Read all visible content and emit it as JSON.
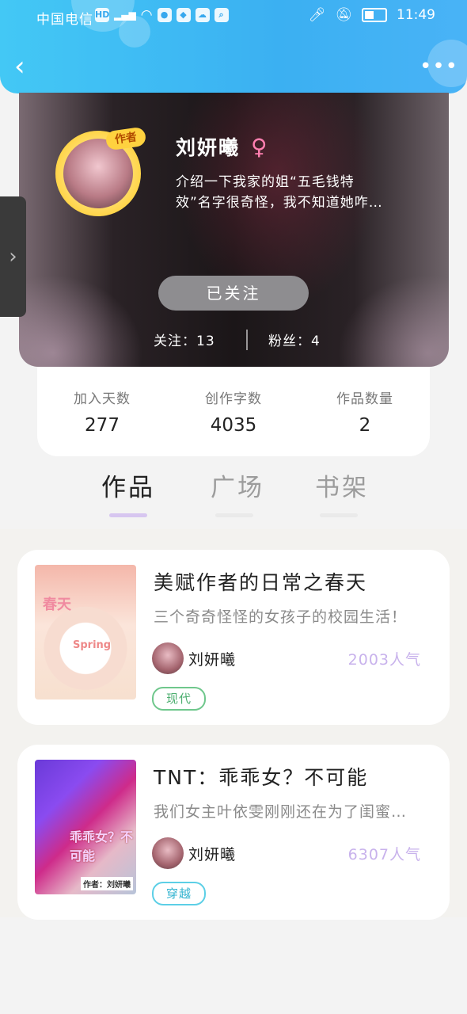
{
  "status_bar": {
    "carrier": "中国电信",
    "network": "HD 4G",
    "time": "11:49"
  },
  "header": {
    "back_icon": "chevron-left-icon",
    "more_icon": "more-icon"
  },
  "profile": {
    "avatar_badge": "作者",
    "name": "刘妍曦",
    "gender_symbol": "♀",
    "bio_line1": "介绍一下我家的姐“五毛钱特",
    "bio_line2": "效”名字很奇怪，我不知道她咋…",
    "follow_button": "已关注",
    "following_label": "关注：",
    "following_count": "13",
    "fans_label": "粉丝：",
    "fans_count": "4"
  },
  "stats": [
    {
      "label": "加入天数",
      "value": "277"
    },
    {
      "label": "创作字数",
      "value": "4035"
    },
    {
      "label": "作品数量",
      "value": "2"
    }
  ],
  "tabs": [
    {
      "label": "作品",
      "active": true
    },
    {
      "label": "广场",
      "active": false
    },
    {
      "label": "书架",
      "active": false
    }
  ],
  "works": [
    {
      "title": "美赋作者的日常之春天",
      "description": "三个奇奇怪怪的女孩子的校园生活！",
      "author": "刘妍曦",
      "popularity": "2003人气",
      "genre": "现代",
      "cover_text_1": "春天",
      "cover_text_2": "Spring"
    },
    {
      "title": "TNT：乖乖女？不可能",
      "description": "我们女主叶依雯刚刚还在为了闺蜜…",
      "author": "刘妍曦",
      "popularity": "6307人气",
      "genre": "穿越",
      "cover_text_1": "乖乖女？不可能",
      "cover_text_2": "作者：刘妍曦"
    }
  ],
  "colors": {
    "header_blue": "#3bb0f2",
    "tab_underline": "#d7c6f0",
    "popularity": "#c8b2ec"
  }
}
